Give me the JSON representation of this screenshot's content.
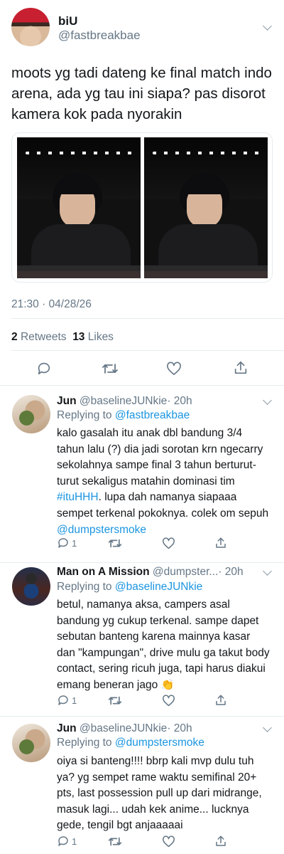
{
  "tweet": {
    "name": "biU",
    "handle": "@fastbreakbae",
    "text": "moots yg tadi dateng ke final match indo arena, ada yg tau ini siapa? pas disorot kamera kok pada nyorakin",
    "timestamp": "21:30 · 04/28/26",
    "retweets_count": "2",
    "retweets_label": "Retweets",
    "likes_count": "13",
    "likes_label": "Likes"
  },
  "replies": [
    {
      "name": "Jun",
      "handle": "@baselineJUNkie",
      "time": "· 20h",
      "replying_label": "Replying to",
      "replying_to": "@fastbreakbae",
      "text_1": "kalo gasalah itu anak dbl bandung 3/4 tahun lalu (?) dia jadi sorotan krn ngecarry sekolahnya sampe final 3 tahun berturut-turut sekaligus matahin dominasi tim ",
      "hashtag": "#ituHHH",
      "text_2": ". lupa dah namanya siapaaa sempet terkenal pokoknya. colek om sepuh ",
      "mention": "@dumpstersmoke",
      "reply_count": "1"
    },
    {
      "name": "Man on A Mission",
      "handle": "@dumpster...",
      "time": "· 20h",
      "replying_label": "Replying to",
      "replying_to": "@baselineJUNkie",
      "text_1": "betul, namanya aksa, campers asal bandung yg cukup terkenal. sampe dapet sebutan banteng karena mainnya kasar dan \"kampungan\", drive mulu ga takut body contact, sering ricuh juga, tapi harus diakui emang beneran jago ",
      "emoji": "👏",
      "reply_count": "1"
    },
    {
      "name": "Jun",
      "handle": "@baselineJUNkie",
      "time": "· 20h",
      "replying_label": "Replying to",
      "replying_to": "@dumpstersmoke",
      "text_1": "oiya si banteng!!!! bbrp kali mvp dulu tuh ya? yg sempet rame waktu semifinal 20+ pts, last possession pull up dari midrange, masuk lagi... udah kek anime... lucknya gede, tengil bgt anjaaaaai",
      "reply_count": "1"
    }
  ],
  "icons": {
    "reply": "reply-icon",
    "retweet": "retweet-icon",
    "like": "heart-icon",
    "share": "share-icon",
    "more": "chevron-down-icon"
  },
  "colors": {
    "link": "#1b95e0",
    "muted": "#657786",
    "text": "#14171a",
    "divider": "#e6ecf0"
  }
}
